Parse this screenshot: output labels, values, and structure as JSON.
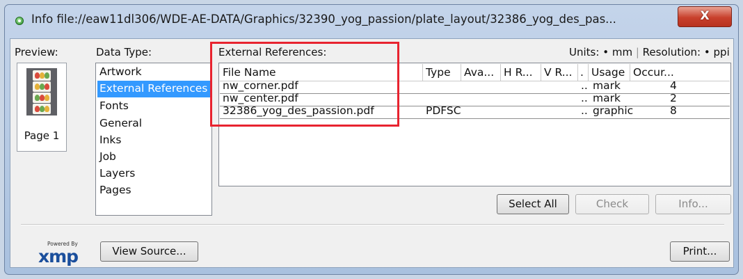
{
  "window": {
    "title": "Info file://eaw11dl306/WDE-AE-DATA/Graphics/32390_yog_passion/plate_layout/32386_yog_des_pas...",
    "close_glyph": "X"
  },
  "preview": {
    "label": "Preview:",
    "page_label": "Page 1"
  },
  "data_type": {
    "label": "Data Type:",
    "items": [
      {
        "label": "Artwork"
      },
      {
        "label": "External References"
      },
      {
        "label": "Fonts"
      },
      {
        "label": "General"
      },
      {
        "label": "Inks"
      },
      {
        "label": "Job"
      },
      {
        "label": "Layers"
      },
      {
        "label": "Pages"
      }
    ],
    "selected": "External References"
  },
  "external_refs": {
    "label": "External References:",
    "units_label": "Units:",
    "units_value": "mm",
    "resolution_label": "Resolution:",
    "resolution_value": "ppi",
    "columns": [
      "File Name",
      "Type",
      "Ava...",
      "H R...",
      "V R...",
      ".",
      "Usage",
      "Occur..."
    ],
    "rows": [
      {
        "file_name": "nw_corner.pdf",
        "type": "",
        "dots": "..",
        "usage": "mark",
        "occur": "4"
      },
      {
        "file_name": "nw_center.pdf",
        "type": "",
        "dots": "..",
        "usage": "mark",
        "occur": "2"
      },
      {
        "file_name": "32386_yog_des_passion.pdf",
        "type": "PDFSC",
        "dots": "..",
        "usage": "graphic",
        "occur": "8"
      }
    ]
  },
  "buttons": {
    "select_all": "Select All",
    "check": "Check",
    "info": "Info...",
    "view_source": "View Source...",
    "print": "Print..."
  },
  "xmp": {
    "powered_by": "Powered By",
    "brand": "xmp"
  },
  "colors": {
    "selection": "#3399ff",
    "highlight_box": "#e8232f",
    "close_button": "#c8402c"
  }
}
